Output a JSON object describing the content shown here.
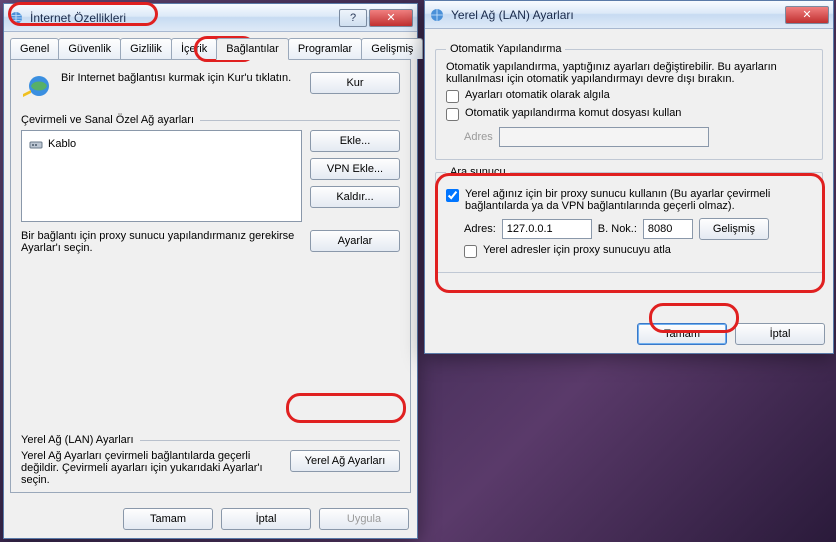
{
  "win1": {
    "title": "İnternet Özellikleri",
    "help_glyph": "?",
    "close_glyph": "✕",
    "tabs": [
      "Genel",
      "Güvenlik",
      "Gizlilik",
      "İçerik",
      "Bağlantılar",
      "Programlar",
      "Gelişmiş"
    ],
    "setup_text": "Bir Internet bağlantısı kurmak için Kur'u tıklatın.",
    "setup_btn": "Kur",
    "dialup_header": "Çevirmeli ve Sanal Özel Ağ ayarları",
    "conn_item": "Kablo",
    "btn_add": "Ekle...",
    "btn_vpn": "VPN Ekle...",
    "btn_remove": "Kaldır...",
    "btn_settings": "Ayarlar",
    "proxy_note": "Bir bağlantı için proxy sunucu yapılandırmanız gerekirse Ayarlar'ı seçin.",
    "lan_header": "Yerel Ağ (LAN) Ayarları",
    "lan_note": "Yerel Ağ Ayarları çevirmeli bağlantılarda geçerli değildir. Çevirmeli ayarları için yukarıdaki Ayarlar'ı seçin.",
    "btn_lan": "Yerel Ağ Ayarları",
    "ok": "Tamam",
    "cancel": "İptal",
    "apply": "Uygula"
  },
  "win2": {
    "title": "Yerel Ağ (LAN) Ayarları",
    "close_glyph": "✕",
    "auto_legend": "Otomatik Yapılandırma",
    "auto_desc": "Otomatik yapılandırma, yaptığınız ayarları değiştirebilir. Bu ayarların kullanılması için otomatik yapılandırmayı devre dışı bırakın.",
    "cb_autodetect": "Ayarları otomatik olarak algıla",
    "cb_autoscript": "Otomatik yapılandırma komut dosyası kullan",
    "addr_label": "Adres",
    "proxy_legend": "Ara sunucu",
    "cb_useproxy": "Yerel ağınız için bir proxy sunucu kullanın (Bu ayarlar çevirmeli bağlantılarda ya da VPN bağlantılarında geçerli olmaz).",
    "addr2_label": "Adres:",
    "addr2_value": "127.0.0.1",
    "port_label": "B. Nok.:",
    "port_value": "8080",
    "btn_adv": "Gelişmiş",
    "cb_bypass": "Yerel adresler için proxy sunucuyu atla",
    "ok": "Tamam",
    "cancel": "İptal"
  }
}
